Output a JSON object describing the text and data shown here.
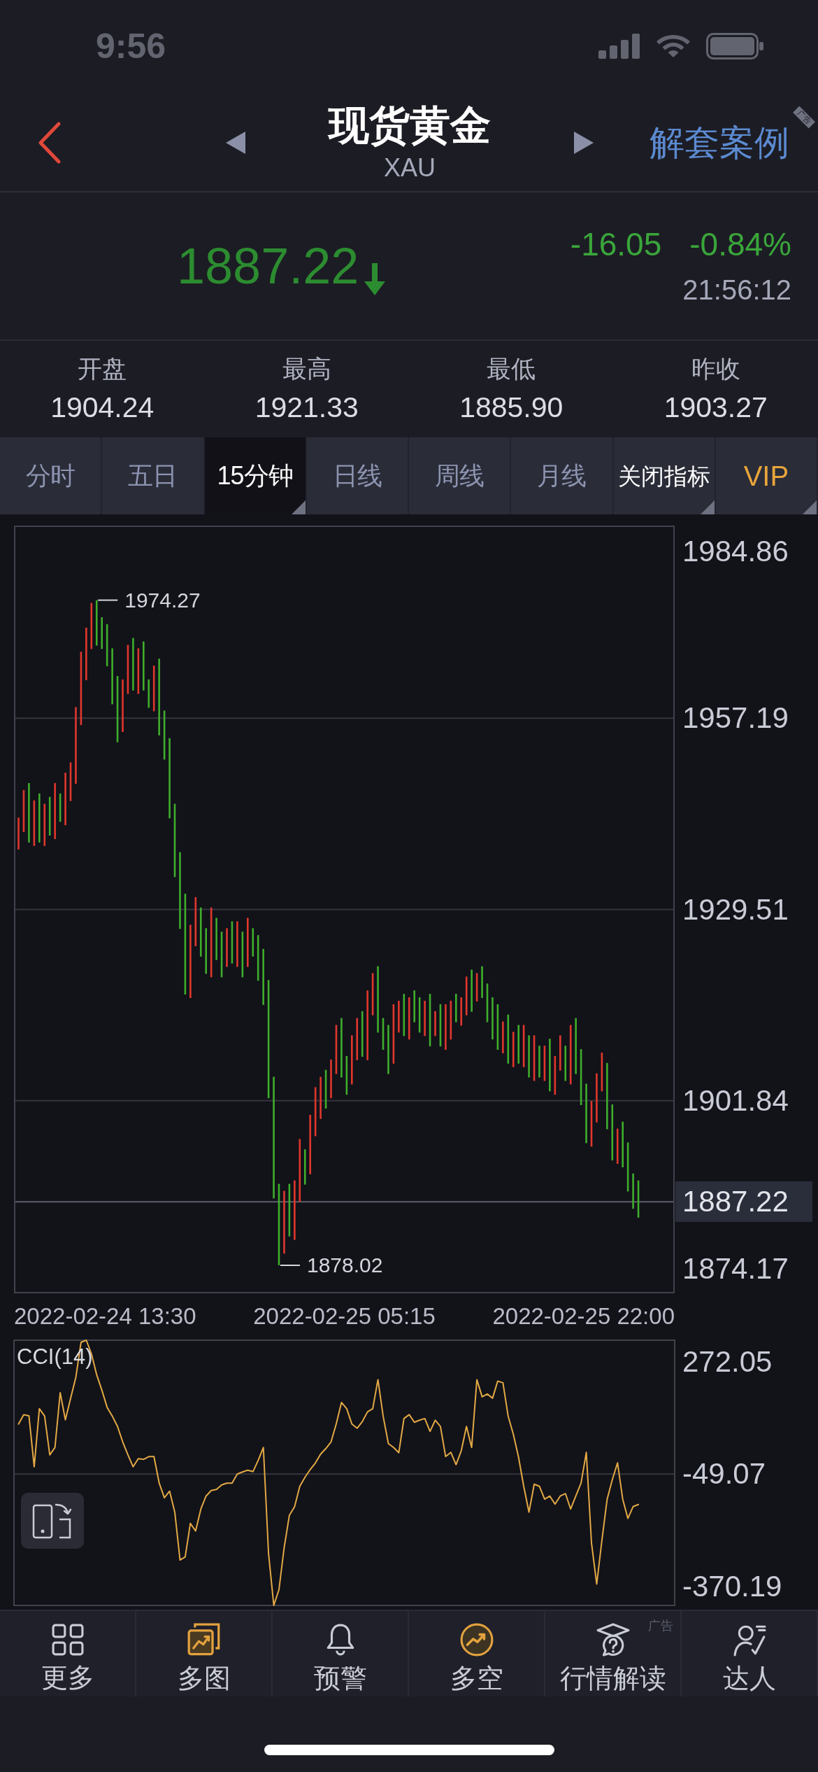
{
  "status_bar": {
    "time": "9:56"
  },
  "header": {
    "title": "现货黄金",
    "symbol": "XAU",
    "action": "解套案例",
    "ad_tag": "广告"
  },
  "quote": {
    "price": "1887.22",
    "falling": true,
    "change": "-16.05",
    "change_percent": "-0.84%",
    "time": "21:56:12"
  },
  "stats": [
    {
      "label": "开盘",
      "value": "1904.24"
    },
    {
      "label": "最高",
      "value": "1921.33"
    },
    {
      "label": "最低",
      "value": "1885.90"
    },
    {
      "label": "昨收",
      "value": "1903.27"
    }
  ],
  "tabs": [
    {
      "label": "分时",
      "kind": "period",
      "selected": false,
      "has_dropdown": false
    },
    {
      "label": "五日",
      "kind": "period",
      "selected": false,
      "has_dropdown": false
    },
    {
      "label": "15分钟",
      "kind": "period",
      "selected": true,
      "has_dropdown": true
    },
    {
      "label": "日线",
      "kind": "period",
      "selected": false,
      "has_dropdown": false
    },
    {
      "label": "周线",
      "kind": "period",
      "selected": false,
      "has_dropdown": false
    },
    {
      "label": "月线",
      "kind": "period",
      "selected": false,
      "has_dropdown": false
    },
    {
      "label": "关闭指标",
      "kind": "indicator",
      "selected": false,
      "has_dropdown": true
    },
    {
      "label": "VIP",
      "kind": "vip",
      "selected": false,
      "has_dropdown": true
    }
  ],
  "price_chart": {
    "y_axis_labels": [
      "1984.86",
      "1957.19",
      "1929.51",
      "1901.84",
      "1874.17"
    ],
    "high_label": "1974.27",
    "low_label": "1878.02",
    "current_price_tag": "1887.22",
    "x_axis_labels": [
      "2022-02-24 13:30",
      "2022-02-25 05:15",
      "2022-02-25 22:00"
    ]
  },
  "indicator_chart": {
    "chart_data": {
      "type": "line",
      "series": [
        {
          "name": "CCI(14)",
          "color": "#e2a944",
          "values": [
            94,
            121,
            118,
            -28,
            138,
            117,
            6,
            27,
            184,
            106,
            168,
            228,
            328,
            334,
            295,
            235,
            191,
            142,
            117,
            87,
            43,
            6,
            -28,
            -5,
            -7,
            1,
            1,
            -75,
            -117,
            -98,
            -158,
            -295,
            -286,
            -190,
            -212,
            -149,
            -112,
            -96,
            -93,
            -80,
            -75,
            -75,
            -49,
            -43,
            -38,
            -42,
            -10,
            27,
            -276,
            -425,
            -380,
            -260,
            -167,
            -142,
            -84,
            -58,
            -36,
            -17,
            8,
            24,
            43,
            94,
            156,
            138,
            94,
            82,
            101,
            129,
            138,
            221,
            117,
            38,
            27,
            12,
            110,
            121,
            99,
            105,
            110,
            73,
            105,
            87,
            1,
            13,
            -22,
            18,
            87,
            27,
            221,
            172,
            180,
            168,
            217,
            212,
            117,
            64,
            -1,
            -84,
            -158,
            -78,
            -84,
            -121,
            -112,
            -135,
            -112,
            -105,
            -149,
            -112,
            -75,
            13,
            -246,
            -364,
            -239,
            -121,
            -65,
            -17,
            -121,
            -176,
            -142,
            -136
          ]
        }
      ],
      "ylim": [
        -425,
        334
      ],
      "yticks": [
        {
          "value": 272.05,
          "label": "272.05"
        },
        {
          "value": -49.07,
          "label": "-49.07"
        },
        {
          "value": -370.19,
          "label": "-370.19"
        }
      ]
    }
  },
  "toolbar": [
    {
      "label": "更多"
    },
    {
      "label": "多图"
    },
    {
      "label": "预警"
    },
    {
      "label": "多空"
    },
    {
      "label": "行情解读",
      "ad_tag": "广告"
    },
    {
      "label": "达人"
    }
  ]
}
